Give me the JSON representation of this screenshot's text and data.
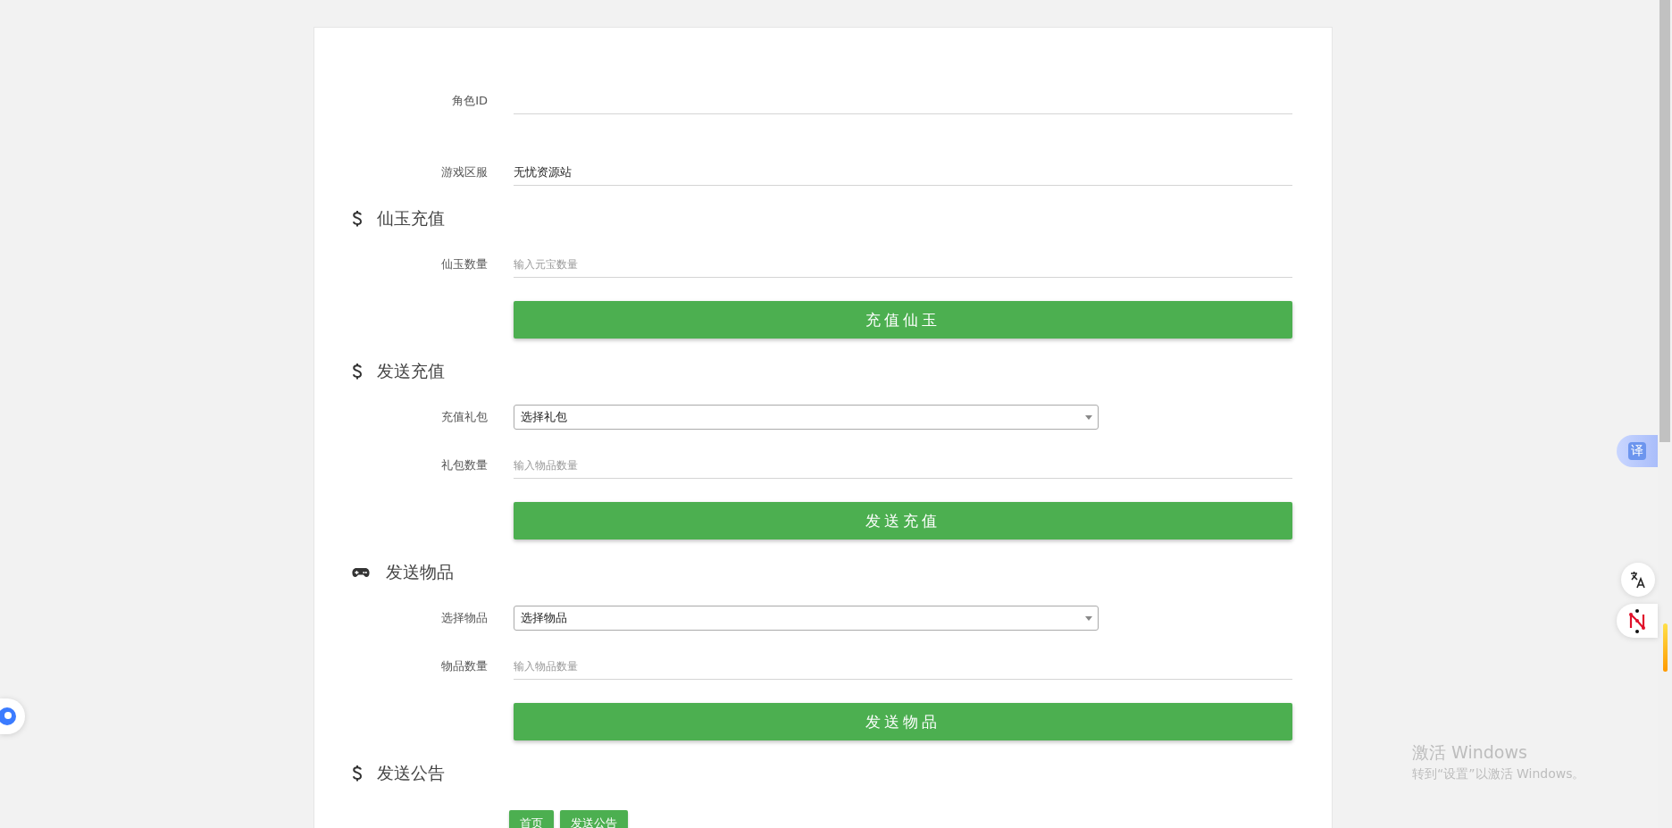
{
  "fields": [
    {
      "kind": "text",
      "label": "角色ID"
    },
    {
      "kind": "text",
      "label": "游戏区服",
      "value": "无忧资源站"
    }
  ],
  "sections": [
    {
      "kind": "dollar",
      "title": "仙玉充值",
      "fields": [
        {
          "kind": "text",
          "label": "仙玉数量",
          "placeholder": "输入元宝数量"
        }
      ],
      "button": "充值仙玉"
    },
    {
      "kind": "dollar",
      "title": "发送充值",
      "fields": [
        {
          "kind": "select",
          "label": "充值礼包",
          "value": "选择礼包"
        },
        {
          "kind": "text",
          "label": "礼包数量",
          "placeholder": "输入物品数量"
        }
      ],
      "button": "发送充值"
    },
    {
      "kind": "gamepad",
      "title": "发送物品",
      "fields": [
        {
          "kind": "select",
          "label": "选择物品",
          "value": "选择物品"
        },
        {
          "kind": "text",
          "label": "物品数量",
          "placeholder": "输入物品数量"
        }
      ],
      "button": "发送物品"
    },
    {
      "kind": "dollar",
      "title": "发送公告",
      "buttons": [
        "首页",
        "发送公告"
      ]
    }
  ],
  "translate_badge": "译",
  "os_notice": {
    "title": "激活 Windows",
    "text": "转到“设置”以激活 Windows。"
  }
}
